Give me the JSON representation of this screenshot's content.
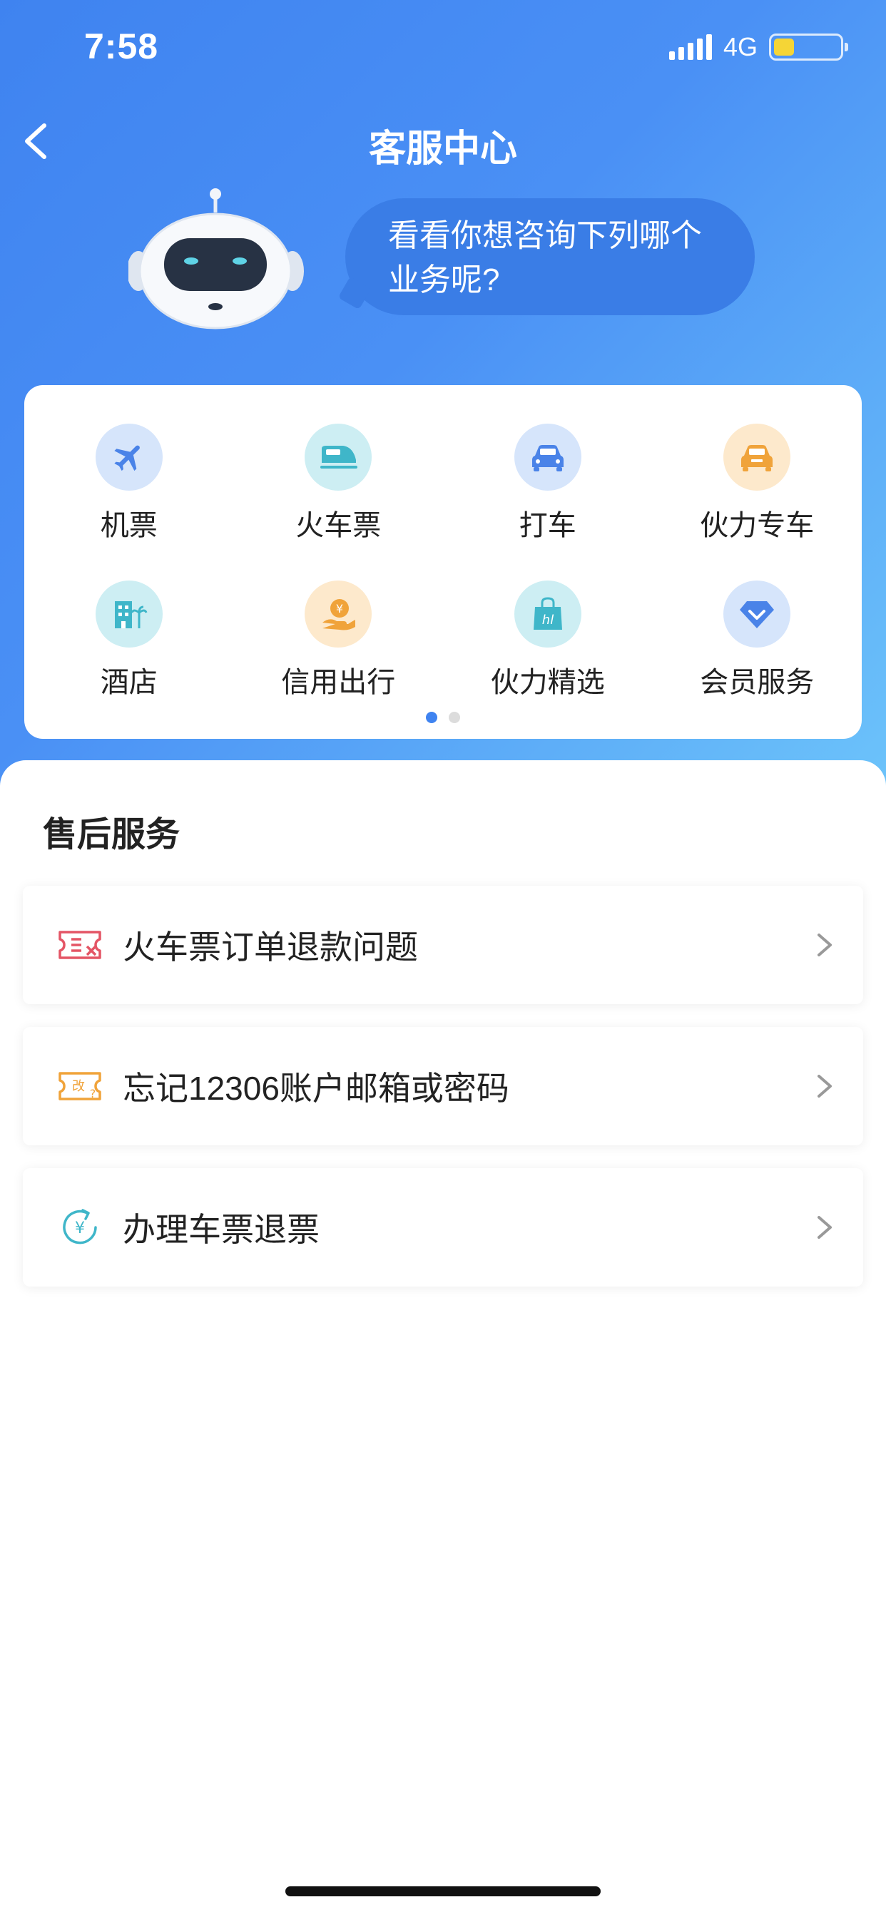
{
  "status_bar": {
    "time": "7:58",
    "network": "4G",
    "battery_level": 0.3,
    "battery_color": "#f5d536"
  },
  "header": {
    "title": "客服中心"
  },
  "assistant": {
    "bubble_line1": "看看你想咨询下列哪个",
    "bubble_line2": "业务呢?"
  },
  "services": {
    "items": [
      {
        "label": "机票",
        "icon": "plane-icon",
        "color": "#4a83e8",
        "bg": "#d6e5fb"
      },
      {
        "label": "火车票",
        "icon": "train-icon",
        "color": "#3fb6c9",
        "bg": "#cdeef3"
      },
      {
        "label": "打车",
        "icon": "car-icon",
        "color": "#4a83e8",
        "bg": "#d6e5fb"
      },
      {
        "label": "伙力专车",
        "icon": "premium-car-icon",
        "color": "#f0a33a",
        "bg": "#fde9cc"
      },
      {
        "label": "酒店",
        "icon": "hotel-icon",
        "color": "#3fb6c9",
        "bg": "#cdeef3"
      },
      {
        "label": "信用出行",
        "icon": "credit-coin-icon",
        "color": "#f0a33a",
        "bg": "#fde9cc"
      },
      {
        "label": "伙力精选",
        "icon": "shopping-bag-icon",
        "color": "#3fb6c9",
        "bg": "#cdeef3"
      },
      {
        "label": "会员服务",
        "icon": "diamond-icon",
        "color": "#4a83e8",
        "bg": "#d6e5fb"
      }
    ],
    "page_current": 1,
    "page_total": 2
  },
  "after_sales": {
    "title": "售后服务",
    "items": [
      {
        "label": "火车票订单退款问题",
        "icon": "ticket-cancel-icon",
        "color": "#e45565"
      },
      {
        "label": "忘记12306账户邮箱或密码",
        "icon": "ticket-change-icon",
        "color": "#f0a33a",
        "icon_text": "改"
      },
      {
        "label": "办理车票退票",
        "icon": "yuan-refund-icon",
        "color": "#3fb6c9",
        "icon_text": "¥"
      }
    ]
  }
}
